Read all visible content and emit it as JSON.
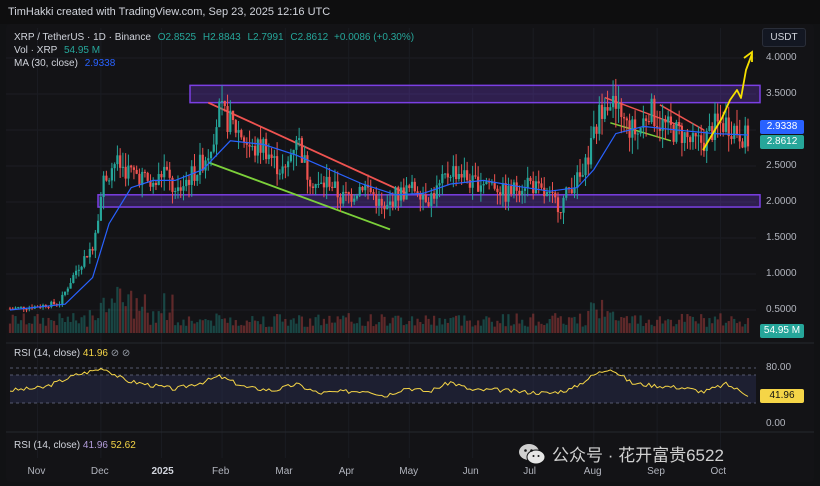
{
  "header": {
    "credit": "TimHakki created with TradingView.com, Sep 23, 2025 12:16 UTC"
  },
  "legend": {
    "symbol": "XRP / TetherUS · 1D · Binance",
    "o_label": "O",
    "o_value": "2.8525",
    "h_label": "H",
    "h_value": "2.8843",
    "l_label": "L",
    "l_value": "2.7991",
    "c_label": "C",
    "c_value": "2.8612",
    "change": "+0.0086 (+0.30%)",
    "vol_label": "Vol · XRP",
    "vol_value": "54.95 M",
    "ma_label": "MA (30, close)",
    "ma_value": "2.9338"
  },
  "rsi_legend": {
    "label": "RSI (14, close)",
    "value": "41.96",
    "extra": "⊘ ⊘"
  },
  "rsi2_legend": {
    "label": "RSI (14, close)",
    "value1": "41.96",
    "value2": "52.62"
  },
  "unit": "USDT",
  "price_badges": {
    "ma": "2.9338",
    "close": "2.8612",
    "volume": "54.95 M",
    "rsi": "41.96"
  },
  "watermark": {
    "text": "公众号 · 花开富贵6522",
    "icon": "wechat-icon"
  },
  "colors": {
    "up": "#26a69a",
    "down": "#ef5350",
    "ma": "#2962ff",
    "zone": "#7b3fe4",
    "rsi": "#f5d547",
    "arrow": "#f5e000",
    "support_line": "#7cd03a",
    "resistance_line": "#ef5350"
  },
  "chart_data": {
    "type": "candlestick",
    "symbol": "XRP / TetherUS",
    "interval": "1D",
    "y_ticks": [
      "4.0000",
      "3.5000",
      "3.0000",
      "2.5000",
      "2.0000",
      "1.5000",
      "1.0000",
      "0.5000"
    ],
    "x_ticks": [
      "Nov",
      "Dec",
      "2025",
      "Feb",
      "Mar",
      "Apr",
      "May",
      "Jun",
      "Jul",
      "Aug",
      "Sep",
      "Oct"
    ],
    "ylim": [
      0.4,
      4.2
    ],
    "rsi_ticks": [
      "80.00",
      "0.00"
    ],
    "rsi_ylim": [
      0,
      100
    ],
    "close_path": [
      [
        0,
        0.52
      ],
      [
        10,
        0.55
      ],
      [
        18,
        0.6
      ],
      [
        24,
        1.05
      ],
      [
        30,
        1.4
      ],
      [
        34,
        2.3
      ],
      [
        38,
        2.55
      ],
      [
        42,
        2.45
      ],
      [
        48,
        2.35
      ],
      [
        52,
        2.2
      ],
      [
        56,
        2.45
      ],
      [
        60,
        2.1
      ],
      [
        64,
        2.3
      ],
      [
        68,
        2.45
      ],
      [
        72,
        2.7
      ],
      [
        76,
        3.25
      ],
      [
        80,
        3.1
      ],
      [
        84,
        2.95
      ],
      [
        88,
        2.7
      ],
      [
        92,
        2.8
      ],
      [
        96,
        2.55
      ],
      [
        100,
        2.4
      ],
      [
        104,
        2.95
      ],
      [
        108,
        2.4
      ],
      [
        112,
        2.2
      ],
      [
        116,
        2.3
      ],
      [
        120,
        2.05
      ],
      [
        124,
        2.1
      ],
      [
        128,
        2.25
      ],
      [
        132,
        2.1
      ],
      [
        136,
        1.85
      ],
      [
        140,
        2.1
      ],
      [
        144,
        2.15
      ],
      [
        148,
        2.2
      ],
      [
        152,
        2.05
      ],
      [
        156,
        2.2
      ],
      [
        160,
        2.45
      ],
      [
        164,
        2.4
      ],
      [
        168,
        2.25
      ],
      [
        172,
        2.3
      ],
      [
        176,
        2.25
      ],
      [
        180,
        2.1
      ],
      [
        184,
        2.2
      ],
      [
        188,
        2.3
      ],
      [
        192,
        2.15
      ],
      [
        196,
        2.05
      ],
      [
        200,
        1.95
      ],
      [
        204,
        2.25
      ],
      [
        208,
        2.35
      ],
      [
        212,
        2.9
      ],
      [
        216,
        3.5
      ],
      [
        220,
        3.3
      ],
      [
        224,
        3.05
      ],
      [
        228,
        2.95
      ],
      [
        232,
        3.3
      ],
      [
        236,
        3.1
      ],
      [
        240,
        3.0
      ],
      [
        244,
        2.95
      ],
      [
        248,
        2.8
      ],
      [
        252,
        2.85
      ],
      [
        256,
        3.05
      ],
      [
        260,
        3.1
      ],
      [
        264,
        3.0
      ],
      [
        268,
        2.86
      ]
    ],
    "ma30_path": [
      [
        0,
        0.5
      ],
      [
        20,
        0.58
      ],
      [
        30,
        0.95
      ],
      [
        36,
        1.7
      ],
      [
        44,
        2.2
      ],
      [
        52,
        2.3
      ],
      [
        60,
        2.3
      ],
      [
        70,
        2.45
      ],
      [
        80,
        2.85
      ],
      [
        92,
        2.8
      ],
      [
        104,
        2.65
      ],
      [
        116,
        2.45
      ],
      [
        128,
        2.25
      ],
      [
        140,
        2.1
      ],
      [
        150,
        2.12
      ],
      [
        160,
        2.25
      ],
      [
        172,
        2.3
      ],
      [
        184,
        2.22
      ],
      [
        196,
        2.15
      ],
      [
        206,
        2.2
      ],
      [
        212,
        2.45
      ],
      [
        220,
        2.95
      ],
      [
        230,
        3.05
      ],
      [
        242,
        3.0
      ],
      [
        256,
        2.95
      ],
      [
        268,
        2.93
      ]
    ],
    "rsi_path": [
      [
        0,
        48
      ],
      [
        12,
        52
      ],
      [
        24,
        70
      ],
      [
        34,
        80
      ],
      [
        42,
        62
      ],
      [
        52,
        55
      ],
      [
        60,
        50
      ],
      [
        70,
        60
      ],
      [
        76,
        68
      ],
      [
        86,
        52
      ],
      [
        96,
        48
      ],
      [
        104,
        57
      ],
      [
        112,
        44
      ],
      [
        120,
        46
      ],
      [
        130,
        48
      ],
      [
        136,
        40
      ],
      [
        144,
        52
      ],
      [
        152,
        46
      ],
      [
        160,
        60
      ],
      [
        168,
        48
      ],
      [
        176,
        49
      ],
      [
        186,
        46
      ],
      [
        196,
        44
      ],
      [
        204,
        50
      ],
      [
        212,
        70
      ],
      [
        218,
        80
      ],
      [
        226,
        58
      ],
      [
        234,
        55
      ],
      [
        244,
        52
      ],
      [
        252,
        46
      ],
      [
        260,
        57
      ],
      [
        268,
        42
      ]
    ],
    "zones": [
      {
        "name": "resistance-zone",
        "low": 3.38,
        "high": 3.62
      },
      {
        "name": "support-zone",
        "low": 1.93,
        "high": 2.1
      }
    ]
  }
}
